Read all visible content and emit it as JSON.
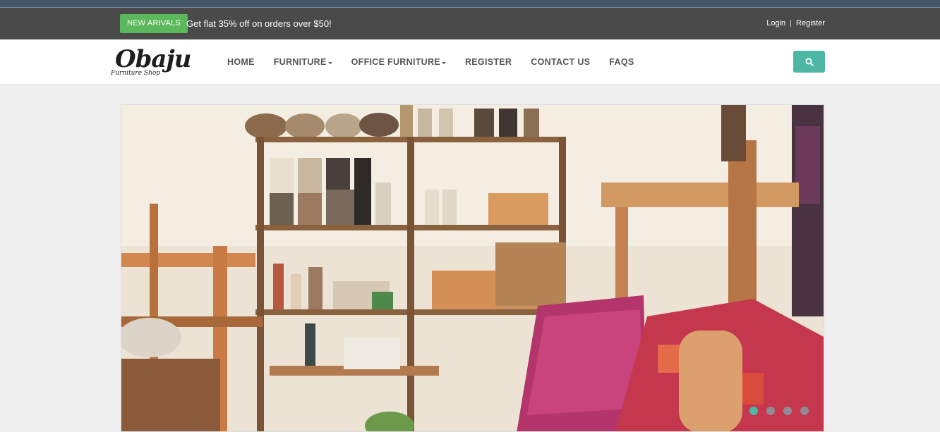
{
  "topbar": {
    "badge": "NEW ARIVALS",
    "promo": "Get flat 35% off on orders over $50!",
    "login": "Login",
    "separator": "|",
    "register": "Register"
  },
  "brand": {
    "name": "Obaju",
    "tagline": "Furniture Shop"
  },
  "nav": {
    "items": [
      {
        "label": "HOME"
      },
      {
        "label": "FURNITURE"
      },
      {
        "label": "OFFICE FURNITURE"
      },
      {
        "label": "REGISTER"
      },
      {
        "label": "CONTACT US"
      },
      {
        "label": "FAQS"
      }
    ],
    "search_icon": "search-icon"
  },
  "slider": {
    "slide_count": 4,
    "active_index": 0
  },
  "colors": {
    "accent": "#4db6a5",
    "badge": "#5cb85c",
    "topbar": "#4a4a4a"
  }
}
